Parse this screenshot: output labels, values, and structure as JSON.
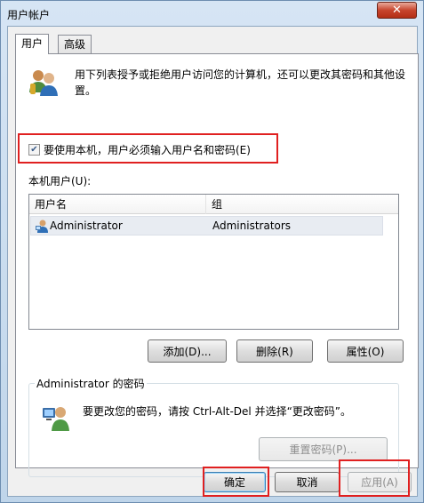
{
  "window": {
    "title": "用户帐户",
    "close_label": "✕"
  },
  "tabs": [
    {
      "label": "用户",
      "active": true
    },
    {
      "label": "高级",
      "active": false
    }
  ],
  "intro": {
    "text": "用下列表授予或拒绝用户访问您的计算机，还可以更改其密码和其他设置。",
    "icon": "users-icon"
  },
  "require_password": {
    "label": "要使用本机，用户必须输入用户名和密码(E)",
    "checked": true
  },
  "local_users": {
    "label": "本机用户(U):",
    "columns": [
      "用户名",
      "组"
    ],
    "rows": [
      {
        "name": "Administrator",
        "group": "Administrators",
        "icon": "user-icon"
      }
    ]
  },
  "list_buttons": {
    "add": "添加(D)...",
    "remove": "删除(R)",
    "properties": "属性(O)"
  },
  "password_group": {
    "title": "Administrator 的密码",
    "text": "要更改您的密码，请按 Ctrl-Alt-Del 并选择“更改密码”。",
    "reset_button": "重置密码(P)...",
    "icon": "user-key-icon"
  },
  "dialog_buttons": {
    "ok": "确定",
    "cancel": "取消",
    "apply": "应用(A)"
  },
  "colors": {
    "highlight_box": "#e02020",
    "title_bar": "#c9dced"
  }
}
